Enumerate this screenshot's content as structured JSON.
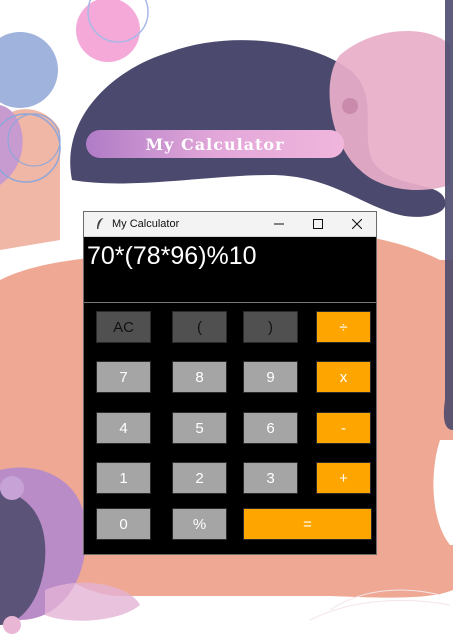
{
  "banner": {
    "title": "My Calculator"
  },
  "window": {
    "title": "My Calculator",
    "icon": "feather-icon",
    "controls": {
      "minimize": "minimize-icon",
      "maximize": "maximize-icon",
      "close": "close-icon"
    }
  },
  "display": {
    "expression": "70*(78*96)%10"
  },
  "keys": {
    "ac": "AC",
    "lparen": "(",
    "rparen": ")",
    "divide": "÷",
    "k7": "7",
    "k8": "8",
    "k9": "9",
    "multiply": "x",
    "k4": "4",
    "k5": "5",
    "k6": "6",
    "minus": "-",
    "k1": "1",
    "k2": "2",
    "k3": "3",
    "plus": "+",
    "k0": "0",
    "percent": "%",
    "equals": "="
  },
  "colors": {
    "operator": "#ffa500",
    "number_key": "#a5a5a5",
    "function_key": "#505050",
    "display_bg": "#000000",
    "banner_start": "#b07cc6",
    "banner_end": "#f0b6dc",
    "navy_blob": "#4b4a6e",
    "salmon_blob": "#efa893"
  }
}
